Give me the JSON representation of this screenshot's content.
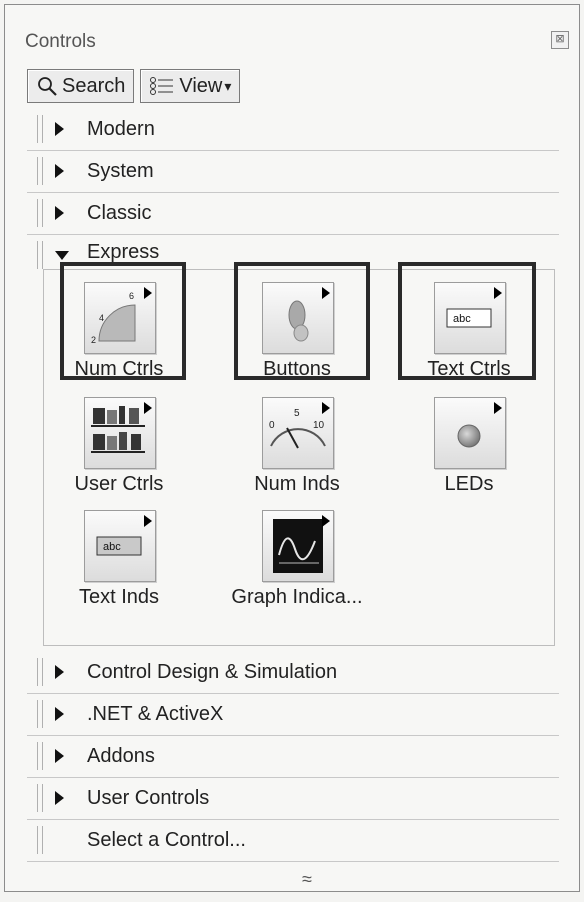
{
  "window": {
    "title": "Controls",
    "close_glyph": "⊠"
  },
  "toolbar": {
    "search_label": "Search",
    "view_label": "View",
    "view_caret": "▾"
  },
  "categories_top": [
    {
      "label": "Modern",
      "state": "collapsed"
    },
    {
      "label": "System",
      "state": "collapsed"
    },
    {
      "label": "Classic",
      "state": "collapsed"
    },
    {
      "label": "Express",
      "state": "expanded"
    }
  ],
  "express_items": [
    {
      "label": "Num Ctrls",
      "icon": "numeric-control-icon",
      "highlighted": true
    },
    {
      "label": "Buttons",
      "icon": "button-icon",
      "highlighted": true
    },
    {
      "label": "Text Ctrls",
      "icon": "text-control-icon",
      "highlighted": true
    },
    {
      "label": "User Ctrls",
      "icon": "user-controls-icon",
      "highlighted": false
    },
    {
      "label": "Num Inds",
      "icon": "numeric-indicator-icon",
      "highlighted": false
    },
    {
      "label": "LEDs",
      "icon": "led-icon",
      "highlighted": false
    },
    {
      "label": "Text Inds",
      "icon": "text-indicator-icon",
      "highlighted": false
    },
    {
      "label": "Graph Indica...",
      "icon": "graph-indicator-icon",
      "highlighted": false
    }
  ],
  "icon_text": {
    "abc": "abc",
    "gauge_ticks": [
      "0",
      "5",
      "10"
    ],
    "knob_ticks": [
      "2",
      "4",
      "6"
    ]
  },
  "categories_bottom": [
    {
      "label": "Control Design & Simulation",
      "state": "collapsed"
    },
    {
      "label": ".NET & ActiveX",
      "state": "collapsed"
    },
    {
      "label": "Addons",
      "state": "collapsed"
    },
    {
      "label": "User Controls",
      "state": "collapsed"
    }
  ],
  "footer": {
    "select_label": "Select a Control...",
    "collapse_glyph": "≈"
  },
  "colors": {
    "highlight_border": "#2a2a2a",
    "panel_bg": "#f7f7f5",
    "separator": "#c8c8c8"
  }
}
